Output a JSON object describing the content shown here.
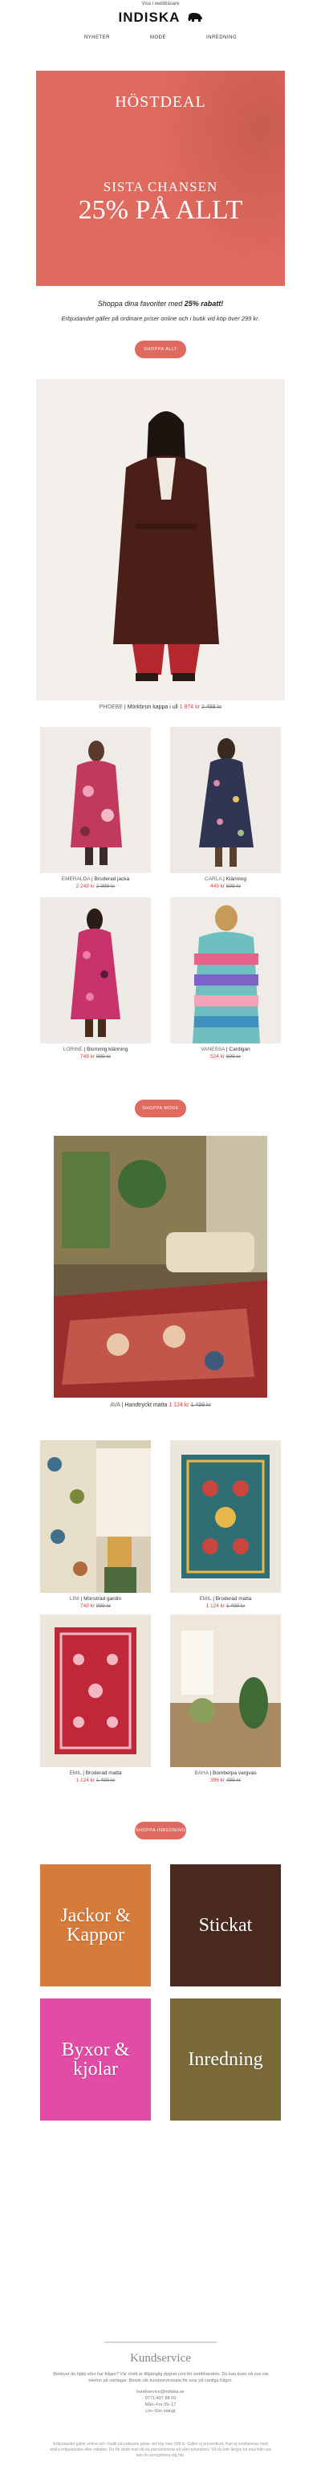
{
  "preheader": "Visa i webbläsare",
  "brand": {
    "name": "INDISKA",
    "logo_icon": "elephant-icon"
  },
  "nav": [
    "NYHETER",
    "MODE",
    "INREDNING"
  ],
  "hero": {
    "kicker": "HÖSTDEAL",
    "line1": "SISTA CHANSEN",
    "line2": "25% PÅ ALLT",
    "bg": "#e06a5e"
  },
  "intro": {
    "text_pre": "Shoppa dina favoriter med ",
    "text_bold": "25% rabatt!",
    "terms": "Erbjudandet gäller på ordinare priser online och i butik vid köp över 299 kr."
  },
  "buttons": {
    "shop_all": "SHOPPA ALLT",
    "shop_fashion": "SHOPPA MODE",
    "shop_interior": "SHOPPA INREDNING"
  },
  "colors": {
    "accent": "#e06a5e",
    "sale": "#d3443a"
  },
  "featured": {
    "brand": "PHOEBE",
    "name": "Mörkbrun kappa i ull",
    "price": "1 874 kr",
    "old": "2 499 kr"
  },
  "fashion": [
    {
      "brand": "EMERALDA",
      "name": "Broderad jacka",
      "price": "2 249 kr",
      "old": "2 999 kr"
    },
    {
      "brand": "CARLA",
      "name": "Klänning",
      "price": "449 kr",
      "old": "599 kr"
    },
    {
      "brand": "LORINE",
      "name": "Blommig klänning",
      "price": "749 kr",
      "old": "999 kr"
    },
    {
      "brand": "VANESSA",
      "name": "Cardigan",
      "price": "524 kr",
      "old": "699 kr"
    }
  ],
  "rug_feature": {
    "brand": "AVA",
    "name": "Handtryckt matta",
    "price": "1 124 kr",
    "old": "1 499 kr"
  },
  "interior": [
    {
      "brand": "LINI",
      "name": "Mönstrad gardin",
      "price": "749 kr",
      "old": "999 kr"
    },
    {
      "brand": "EMIL",
      "name": "Broderad matta",
      "price": "1 124 kr",
      "old": "1 499 kr"
    },
    {
      "brand": "EMIL",
      "name": "Broderad matta",
      "price": "1 124 kr",
      "old": "1 499 kr"
    },
    {
      "brand": "BAHA",
      "name": "Bomberpa vargvas",
      "price": "396 kr",
      "old": "499 kr"
    }
  ],
  "categories": [
    "Jackor & Kappor",
    "Stickat",
    "Byxor & kjolar",
    "Inredning"
  ],
  "customer_service": {
    "title": "Kundservice",
    "body": "Behöver du hjälp eller har frågor? Vår chatt är tillgänglig dygnet runt för webbhandeln. Du kan även nå oss via telefon på vardagar. Besök vår kundservicesida för svar på vanliga frågor.",
    "email": "kundservice@indiska.se",
    "phone": "0771-407 88 00",
    "hours": "Mån–Fre 09–17",
    "extra": "Lör–Sön stängt"
  },
  "footer": "Erbjudandet gäller online och i butik på ordinarie priser vid köp över 299 kr. Gäller ej presentkort. Kan ej kombineras med andra erbjudanden eller rabatter. Du får detta mail då du prenumererar på vårt nyhetsbrev. Vill du inte längre ha mail från oss kan du avregistrera dig här."
}
